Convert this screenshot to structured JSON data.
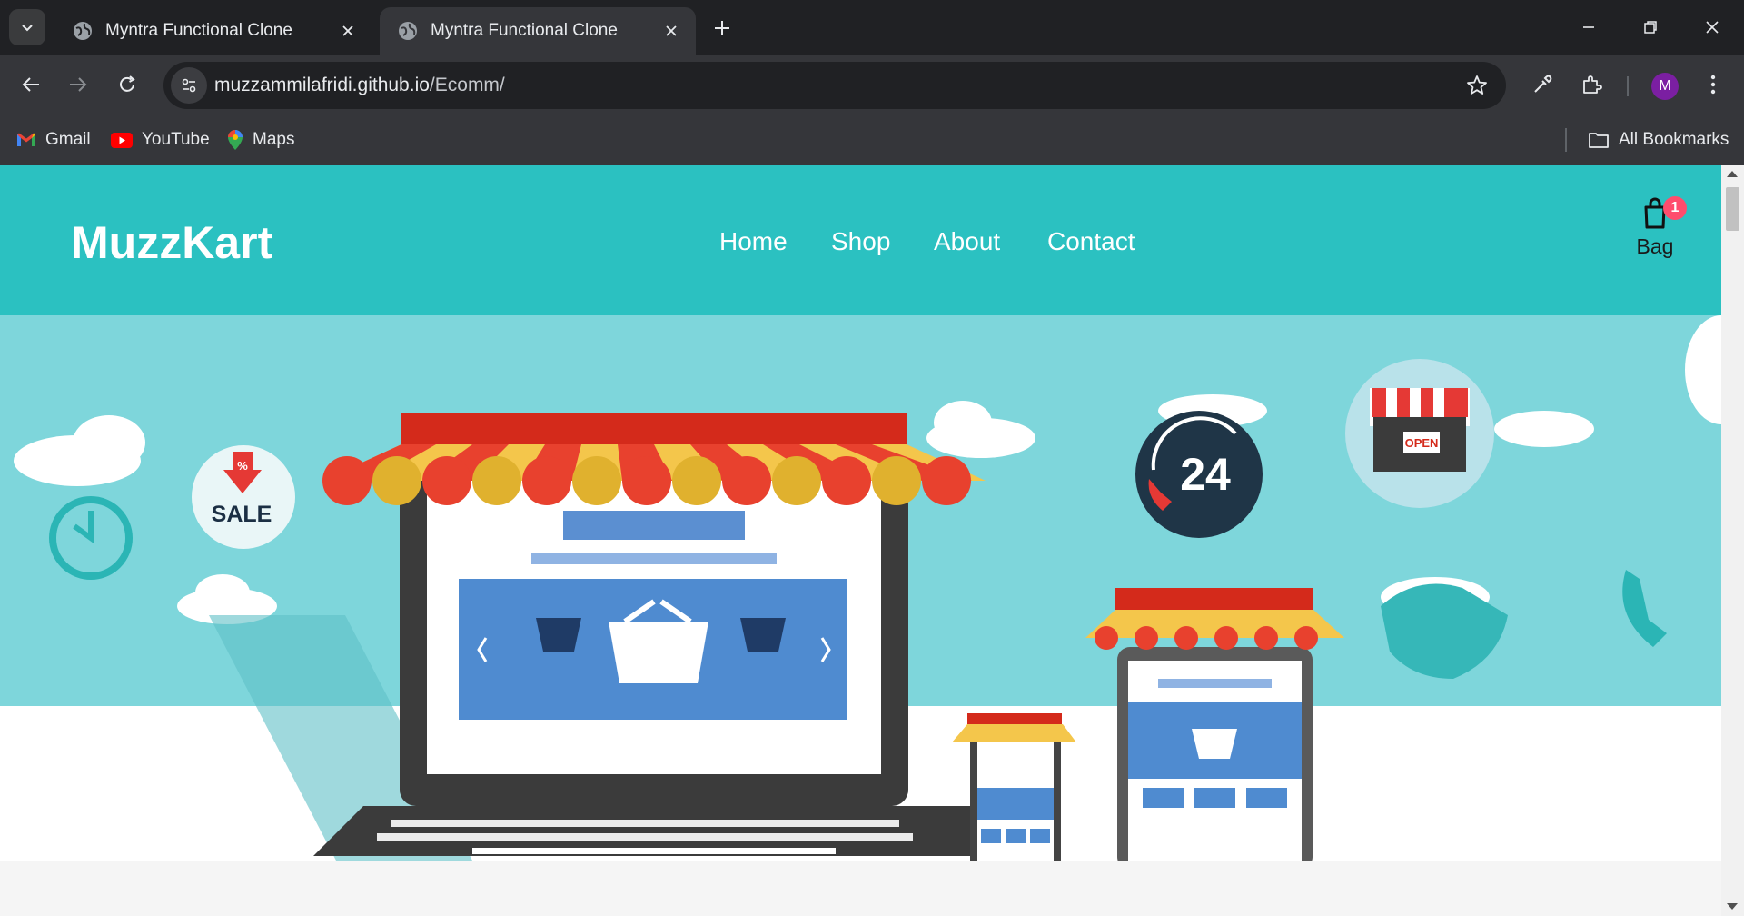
{
  "browser": {
    "tabs": [
      {
        "title": "Myntra Functional Clone",
        "active": false
      },
      {
        "title": "Myntra Functional Clone",
        "active": true
      }
    ],
    "url_host": "muzzammilafridi.github.io",
    "url_path": "/Ecomm/",
    "profile_initial": "M",
    "bookmarks": [
      {
        "label": "Gmail",
        "icon": "gmail-icon"
      },
      {
        "label": "YouTube",
        "icon": "youtube-icon"
      },
      {
        "label": "Maps",
        "icon": "maps-icon"
      }
    ],
    "all_bookmarks_label": "All Bookmarks"
  },
  "site": {
    "logo": "MuzzKart",
    "nav": [
      "Home",
      "Shop",
      "About",
      "Contact"
    ],
    "bag_label": "Bag",
    "bag_count": "1",
    "header_color": "#2bc1c1",
    "badge_color": "#ff4d6d"
  },
  "hero": {
    "sale_text": "SALE",
    "sale_percent": "%",
    "support_number": "24",
    "open_sign": "OPEN"
  }
}
